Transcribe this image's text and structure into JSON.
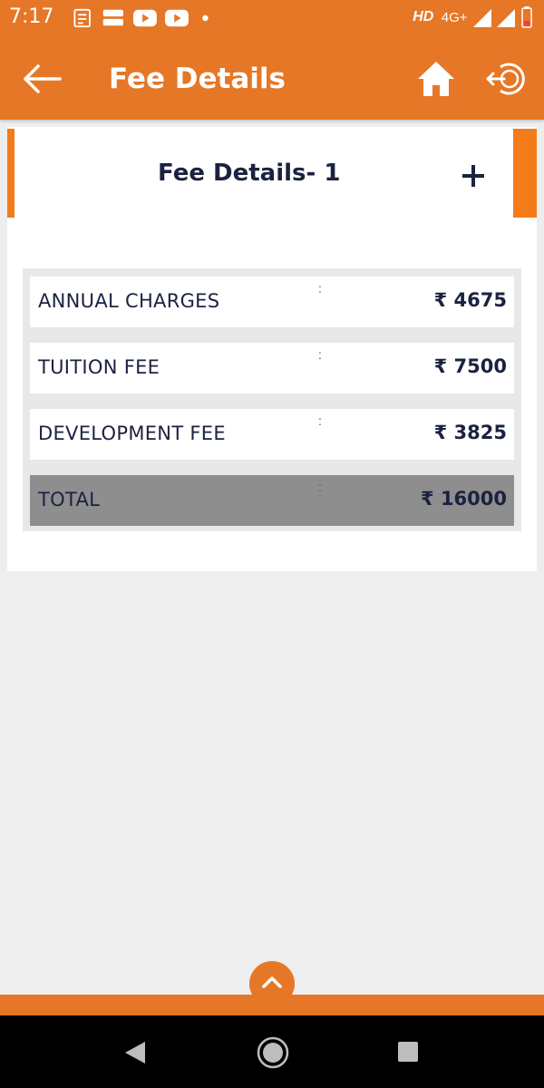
{
  "status_bar": {
    "time": "7:17",
    "network": "HD",
    "network_type": "4G+",
    "left_icons": [
      "news-icon",
      "dainik-bhaskar-icon",
      "youtube-icon",
      "youtube-icon",
      "dot-icon"
    ],
    "right_icons": [
      "signal-icon",
      "signal-icon",
      "battery-low-icon"
    ]
  },
  "app_bar": {
    "title": "Fee Details",
    "icons": [
      "back-arrow-icon",
      "home-icon",
      "logout-icon"
    ],
    "color": "#e67726"
  },
  "card": {
    "title": "Fee Details- 1",
    "expand_icon": "plus-icon"
  },
  "fee_table": {
    "rows": [
      {
        "label": "ANNUAL CHARGES",
        "separator": ":",
        "amount": "₹ 4675"
      },
      {
        "label": "TUITION FEE",
        "separator": ":",
        "amount": "₹ 7500"
      },
      {
        "label": "DEVELOPMENT FEE",
        "separator": ":",
        "amount": "₹ 3825"
      }
    ],
    "total": {
      "label": "TOTAL",
      "separator": ":",
      "amount": "₹ 16000"
    }
  },
  "footer": {
    "scroll_up_icon": "chevron-up-icon"
  },
  "nav_bar": {
    "icons": [
      "nav-back-icon",
      "nav-home-icon",
      "nav-recents-icon"
    ]
  }
}
